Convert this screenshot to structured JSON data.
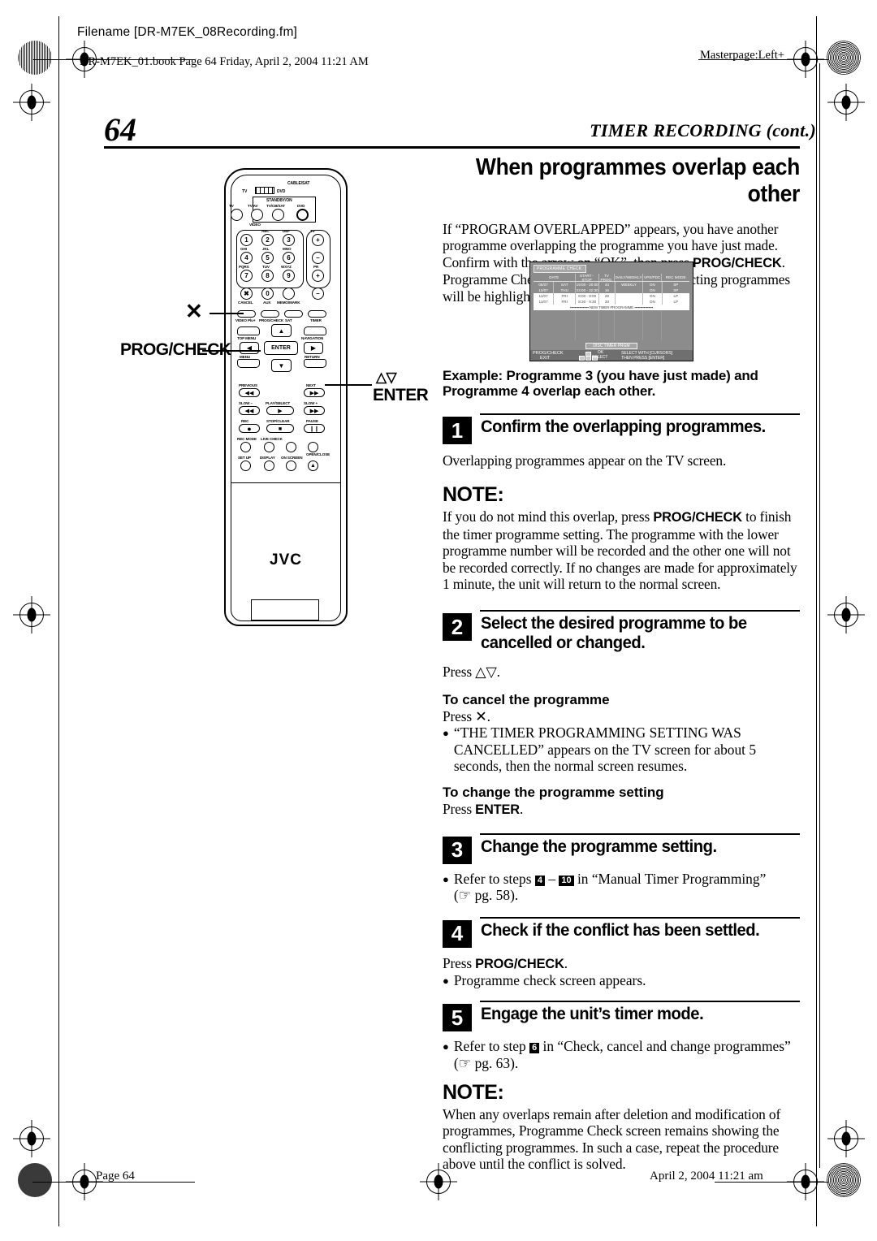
{
  "header": {
    "filename": "Filename [DR-M7EK_08Recording.fm]",
    "bookline": "DR-M7EK_01.book  Page 64  Friday, April 2, 2004  11:21 AM",
    "masterpage": "Masterpage:Left+"
  },
  "footer": {
    "page": "Page 64",
    "date": "April 2, 2004 11:21 am"
  },
  "page": {
    "number": "64",
    "running_head": "TIMER RECORDING (cont.)",
    "section_title": "When programmes overlap each other"
  },
  "intro": "If “PROGRAM OVERLAPPED” appears, you have another programme overlapping the programme you have just made. Confirm with the arrow on “OK”, then press ",
  "intro_bold": "PROG/CHECK",
  "intro_rest": ". Programme Check screen appears and conflicting programmes will be highlighted in pink.",
  "tv_screen": {
    "tab": "PROGRAMME CHECK",
    "columns": [
      "DATE",
      "START - STOP",
      "TV PROG.",
      "DAILY/WEEKLY",
      "VPS/PDC",
      "REC MODE"
    ],
    "rows": [
      {
        "date": "05/07",
        "day": "SAT",
        "time": "19:00 - 20:00",
        "prog": "44",
        "repeat": "WEEKLY",
        "vps": "ON",
        "mode": "SP",
        "highlight": false
      },
      {
        "date": "10/07",
        "day": "THU",
        "time": "22:00 - 22:30",
        "prog": "16",
        "repeat": "",
        "vps": "ON",
        "mode": "XP",
        "highlight": false
      },
      {
        "date": "11/07",
        "day": "FRI",
        "time": "8:00 -  9:00",
        "prog": "28",
        "repeat": "",
        "vps": "ON",
        "mode": "LP",
        "highlight": true
      },
      {
        "date": "11/07",
        "day": "FRI",
        "time": "8:30 -  9:30",
        "prog": "33",
        "repeat": "",
        "vps": "ON",
        "mode": "LP",
        "highlight": true
      }
    ],
    "new_timer_row": "▪▪▪▪▪▪▪▪▪▪▪▪▪▪▪▪ NEW TIMER PROGRAMME ▪▪▪▪▪▪▪▪▪▪▪▪▪▪▪▪",
    "disc_button": "DISC TIMER PRGM",
    "footer_prog_check": "PROG/CHECK",
    "footer_exit": "EXIT",
    "footer_ok": "OK",
    "footer_select": "SELECT",
    "footer_hint_1": "SELECT WITH [CURSORS]",
    "footer_hint_2": "THEN PRESS [ENTER]"
  },
  "example": "Example: Programme 3 (you have just made) and Programme 4 overlap each other.",
  "steps": [
    {
      "num": "1",
      "title": "Confirm the overlapping programmes.",
      "body": "Overlapping programmes appear on the TV screen."
    },
    {
      "num": "2",
      "title": "Select the desired programme to be cancelled or changed.",
      "body": "Press △▽."
    },
    {
      "num": "3",
      "title": "Change the programme setting."
    },
    {
      "num": "4",
      "title": "Check if the conflict has been settled."
    },
    {
      "num": "5",
      "title": "Engage the unit’s timer mode."
    }
  ],
  "note1": {
    "label": "NOTE:",
    "text_a": "If you do not mind this overlap, press ",
    "bold": "PROG/CHECK",
    "text_b": " to finish the timer programme setting. The programme with the lower programme number will be recorded and the other one will not be recorded correctly. If no changes are made for approximately 1 minute, the unit will return to the normal screen."
  },
  "cancel_section": {
    "heading": "To cancel the programme",
    "press": "Press ✕.",
    "bullet": "“THE TIMER PROGRAMMING SETTING WAS CANCELLED” appears on the TV screen for about 5 seconds, then the normal screen resumes."
  },
  "change_section": {
    "heading": "To change the programme setting",
    "press_pre": "Press ",
    "press_bold": "ENTER",
    "press_post": "."
  },
  "step3_bullet": {
    "pre": "Refer to steps ",
    "n1": "4",
    "mid": " – ",
    "n2": "10",
    "post": " in “Manual Timer Programming”",
    "pg": "(☞ pg. 58)."
  },
  "step4_body": {
    "press_pre": "Press ",
    "press_bold": "PROG/CHECK",
    "press_post": ".",
    "bullet": "Programme check screen appears."
  },
  "step5_bullet": {
    "pre": "Refer to step ",
    "n1": "6",
    "post": " in “Check, cancel and change programmes”",
    "pg": "(☞ pg. 63)."
  },
  "note2": {
    "label": "NOTE:",
    "text": "When any overlaps remain after deletion and modification of programmes, Programme Check screen remains showing the conflicting programmes. In such a case, repeat the procedure above until the conflict is solved."
  },
  "remote": {
    "brand": "JVC",
    "labels": {
      "cable_sat": "CABLE/SAT",
      "tv": "TV",
      "dvd": "DVD",
      "standby": "STANDBY/ON",
      "tv_mute": "TV",
      "tv_av": "TV AV",
      "video": "VIDEO",
      "tv_cb_sat": "TV/CB/SAT",
      "dvd2": "DVD",
      "abc": "ABC",
      "def": "DEF",
      "ghi": "GHI",
      "jkl": "JKL",
      "mno": "MNO",
      "pqrs": "PQRS",
      "tuv": "TUV",
      "wxyz": "WXYZ",
      "tv_vol": "TV",
      "pr": "PR",
      "cancel": "CANCEL",
      "aux": "AUX",
      "memo_mark": "MEMO/MARK",
      "videoplus": "VIDEO Plu+",
      "prog_check": "PROG/CHECK",
      "sat": "SAT",
      "timer": "TIMER",
      "top_menu": "TOP MENU",
      "navigation": "NAVIGATION",
      "enter": "ENTER",
      "menu": "MENU",
      "return": "RETURN",
      "previous": "PREVIOUS",
      "next": "NEXT",
      "slow_minus": "SLOW –",
      "play_select": "PLAY/SELECT",
      "slow_plus": "SLOW +",
      "rec": "REC",
      "stop_clear": "STOP/CLEAR",
      "pause": "PAUSE",
      "rec_mode": "REC MODE",
      "live_check": "LIVE CHECK",
      "set_up": "SET UP",
      "display": "DISPLAY",
      "on_screen": "ON SCREEN",
      "open_close": "OPEN/CLOSE"
    },
    "keys": [
      "1",
      "2",
      "3",
      "4",
      "5",
      "6",
      "7",
      "8",
      "9",
      "0"
    ],
    "callouts": {
      "cancel_x": "✕",
      "prog_check": "PROG/CHECK",
      "updown": "△▽",
      "enter": "ENTER"
    }
  }
}
